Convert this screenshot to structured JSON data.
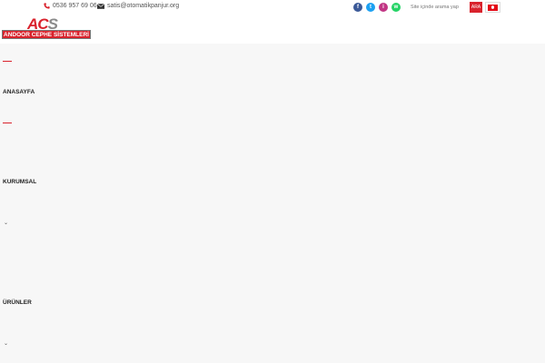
{
  "topbar": {
    "phone": "0536 957 69 06",
    "email": "satis@otomatikpanjur.org",
    "socials": [
      {
        "icon": "facebook-icon",
        "glyph": "f",
        "color": "#3b5998"
      },
      {
        "icon": "twitter-icon",
        "glyph": "t",
        "color": "#1da1f2"
      },
      {
        "icon": "instagram-icon",
        "glyph": "i",
        "color": "#c13584"
      },
      {
        "icon": "whatsapp-icon",
        "glyph": "w",
        "color": "#25d366"
      }
    ],
    "search_placeholder": "Site içinde arama yap",
    "search_button": "ARA",
    "language_flag": "turkey-flag-icon"
  },
  "logo": {
    "mark_a": "AC",
    "mark_b": "S",
    "text": "ANDOOR CEPHE SİSTEMLERİ"
  },
  "menu": {
    "items": [
      "ANASAYFA",
      "KURUMSAL",
      "ÜRÜNLER"
    ],
    "chevron": "⌄"
  },
  "colors": {
    "accent": "#d9232d",
    "background": "#f7f7f7"
  }
}
